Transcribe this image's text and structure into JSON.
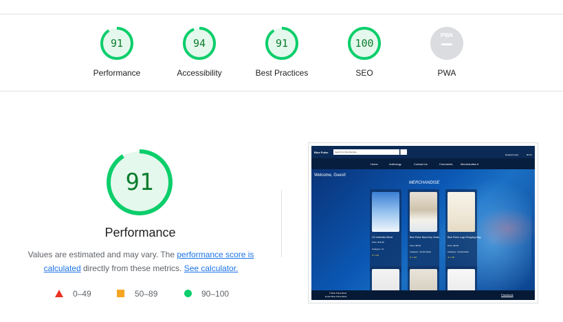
{
  "categories": [
    {
      "key": "performance",
      "score": "91",
      "label": "Performance"
    },
    {
      "key": "accessibility",
      "score": "94",
      "label": "Accessibility"
    },
    {
      "key": "best_practices",
      "score": "91",
      "label": "Best Practices"
    },
    {
      "key": "seo",
      "score": "100",
      "label": "SEO"
    }
  ],
  "pwa": {
    "badge": "PWA",
    "label": "PWA"
  },
  "main": {
    "score": "91",
    "title": "Performance",
    "desc_1": "Values are estimated and may vary. The ",
    "desc_link_1": "performance score is calculated",
    "desc_2": " directly from these metrics. ",
    "desc_link_2": "See calculator."
  },
  "legend": [
    {
      "range": "0–49",
      "color": "#eb3323"
    },
    {
      "range": "50–89",
      "color": "#f6a623"
    },
    {
      "range": "90–100",
      "color": "#0cce6b"
    }
  ],
  "colors": {
    "pass": "#0cce6b",
    "pass_text": "#0a7d2c",
    "pass_bg": "#e5f8ed",
    "neutral": "#bdc1c6"
  },
  "screenshot": {
    "brand": "Blue Pulse",
    "search_placeholder": "Search for Merchandise",
    "account": "Register/Login",
    "cart": "$0.00",
    "nav": [
      "Home",
      "Anthology",
      "Contact Us",
      "Comments",
      "Merchandise ▾"
    ],
    "welcome": "Welcome, Guest!",
    "heading": "MERCHANDISE",
    "products": [
      {
        "name": "CD Umbrella Street",
        "price": "Price: $10.00",
        "category": "Category: cd"
      },
      {
        "name": "Blue Pulse Band Key Chain",
        "price": "Price: $5.00",
        "category": "Category: merchandise"
      },
      {
        "name": "Blue Pulse Logo Shopping Bag",
        "price": "Price: $5.00",
        "category": "Category: merchandise"
      }
    ],
    "rating": "★ 1.0/5",
    "footer_line_1": "© Blue Pulse Band",
    "footer_line_2": "Email: Blue Pulse Band",
    "facebook": "Facebook"
  }
}
